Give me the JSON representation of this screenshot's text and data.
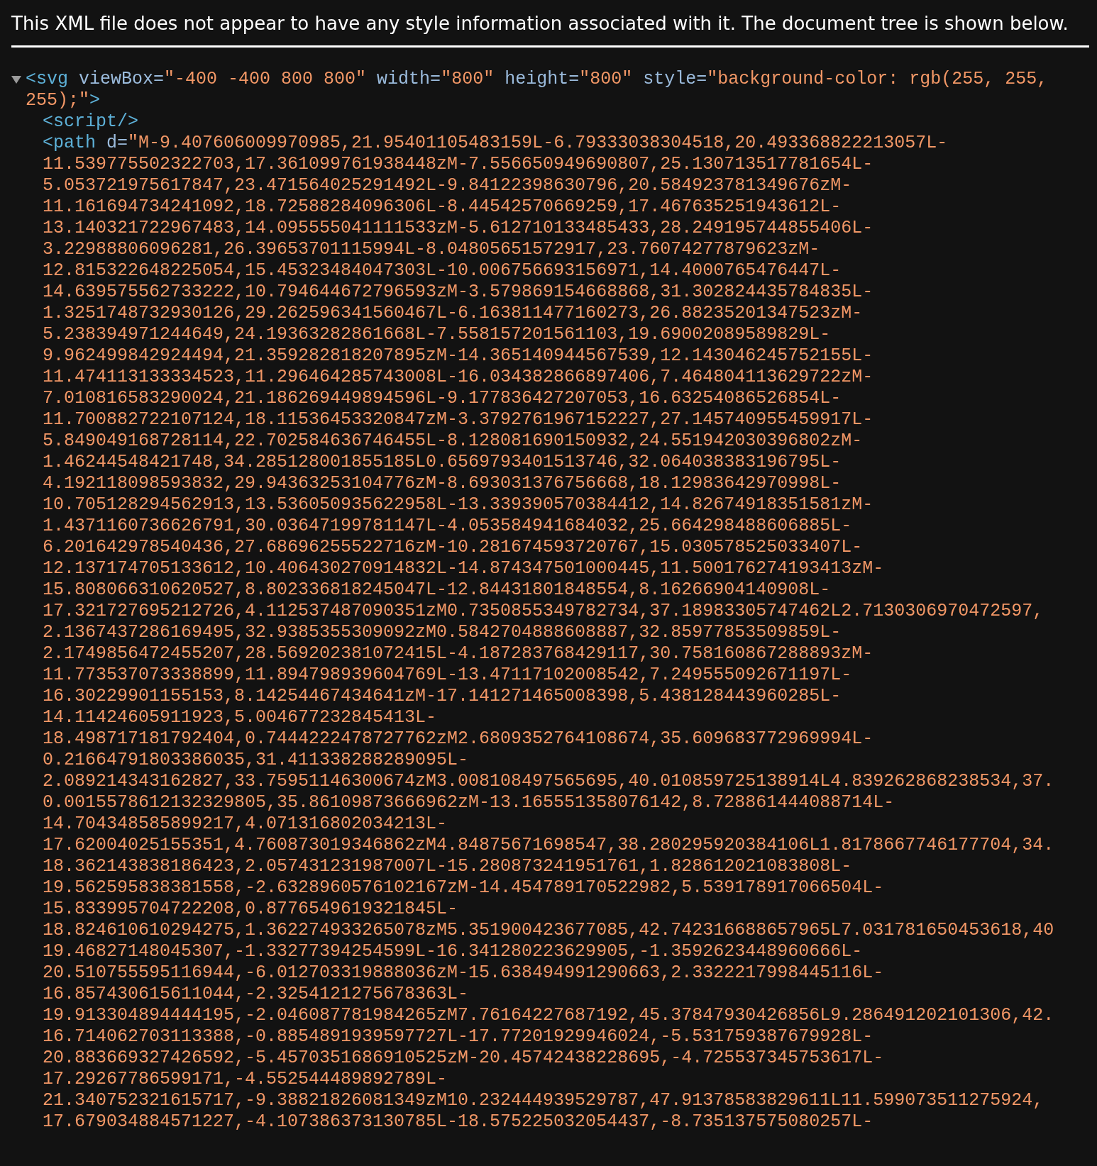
{
  "notice": "This XML file does not appear to have any style information associated with it. The document tree is shown below.",
  "tree": {
    "expanded": true,
    "lines": [
      [
        {
          "kind": "tag",
          "text": "<svg"
        },
        {
          "kind": "attr",
          "text": " viewBox="
        },
        {
          "kind": "value",
          "text": "\"-400 -400 800 800\""
        },
        {
          "kind": "attr",
          "text": " width="
        },
        {
          "kind": "value",
          "text": "\"800\""
        },
        {
          "kind": "attr",
          "text": " height="
        },
        {
          "kind": "value",
          "text": "\"800\""
        },
        {
          "kind": "attr",
          "text": " style="
        },
        {
          "kind": "value",
          "text": "\"background-color: rgb(255, 255,"
        }
      ],
      [
        {
          "kind": "value",
          "text": "255);\""
        },
        {
          "kind": "tag",
          "text": ">"
        }
      ]
    ],
    "children": [
      {
        "lines": [
          [
            {
              "kind": "tag",
              "text": "<script/>"
            }
          ]
        ]
      },
      {
        "lines": [
          [
            {
              "kind": "tag",
              "text": "<path"
            },
            {
              "kind": "attr",
              "text": " d="
            },
            {
              "kind": "value",
              "text": "\"M-9.407606009970985,21.95401105483159L-6.79333038304518,20.493368822213057L-"
            }
          ],
          [
            {
              "kind": "value",
              "text": "11.539775502322703,17.361099761938448zM-7.556650949690807,25.130713517781654L-"
            }
          ],
          [
            {
              "kind": "value",
              "text": "5.053721975617847,23.471564025291492L-9.84122398630796,20.584923781349676zM-"
            }
          ],
          [
            {
              "kind": "value",
              "text": "11.161694734241092,18.72588284096306L-8.44542570669259,17.467635251943612L-"
            }
          ],
          [
            {
              "kind": "value",
              "text": "13.140321722967483,14.095555041111533zM-5.612710133485433,28.249195744855406L-"
            }
          ],
          [
            {
              "kind": "value",
              "text": "3.22988806096281,26.39653701115994L-8.04805651572917,23.76074277879623zM-"
            }
          ],
          [
            {
              "kind": "value",
              "text": "12.815322648225054,15.45323484047303L-10.006756693156971,14.4000765476447L-"
            }
          ],
          [
            {
              "kind": "value",
              "text": "14.639575562733222,10.794644672796593zM-3.579869154668868,31.302824435784835L-"
            }
          ],
          [
            {
              "kind": "value",
              "text": "1.3251748732930126,29.262596341560467L-6.163811477160273,26.88235201347523zM-"
            }
          ],
          [
            {
              "kind": "value",
              "text": "5.238394971244649,24.19363282861668L-7.558157201561103,19.69002089589829L-"
            }
          ],
          [
            {
              "kind": "value",
              "text": "9.962499842924494,21.359282818207895zM-14.365140944567539,12.143046245752155L-"
            }
          ],
          [
            {
              "kind": "value",
              "text": "11.474113133334523,11.296464285743008L-16.034382866897406,7.464804113629722zM-"
            }
          ],
          [
            {
              "kind": "value",
              "text": "7.010816583290024,21.186269449894596L-9.177836427207053,16.63254086526854L-"
            }
          ],
          [
            {
              "kind": "value",
              "text": "11.700882722107124,18.11536453320847zM-3.3792761967152227,27.145740955459917L-"
            }
          ],
          [
            {
              "kind": "value",
              "text": "5.849049168728114,22.702584636746455L-8.128081690150932,24.551942030396802zM-"
            }
          ],
          [
            {
              "kind": "value",
              "text": "1.46244548421748,34.285128001855185L0.6569793401513746,32.064038383196795L-"
            }
          ],
          [
            {
              "kind": "value",
              "text": "4.192118098593832,29.94363253104776zM-8.693031376756668,18.12983642970998L-"
            }
          ],
          [
            {
              "kind": "value",
              "text": "10.705128294562913,13.536050935622958L-13.339390570384412,14.82674918351581zM-"
            }
          ],
          [
            {
              "kind": "value",
              "text": "1.4371160736626791,30.03647199781147L-4.053584941684032,25.664298488606885L-"
            }
          ],
          [
            {
              "kind": "value",
              "text": "6.201642978540436,27.68696255522716zM-10.281674593720767,15.030578525033407L-"
            }
          ],
          [
            {
              "kind": "value",
              "text": "12.137174705133612,10.406430270914832L-14.874347501000445,11.500176274193413zM-"
            }
          ],
          [
            {
              "kind": "value",
              "text": "15.808066310620527,8.802336818245047L-12.84431801848554,8.16266904140908L-"
            }
          ],
          [
            {
              "kind": "value",
              "text": "17.321727695212726,4.112537487090351zM0.7350855349782734,37.18983305747462L2.7130306970472597,"
            }
          ],
          [
            {
              "kind": "value",
              "text": "2.1367437286169495,32.9385355309092zM0.5842704888608887,32.85977853509859L-"
            }
          ],
          [
            {
              "kind": "value",
              "text": "2.1749856472455207,28.569202381072415L-4.187283768429117,30.758160867288893zM-"
            }
          ],
          [
            {
              "kind": "value",
              "text": "11.773537073338899,11.894798939604769L-13.47117102008542,7.249555092671197L-"
            }
          ],
          [
            {
              "kind": "value",
              "text": "16.30229901155153,8.14254467434641zM-17.141271465008398,5.438128443960285L-"
            }
          ],
          [
            {
              "kind": "value",
              "text": "14.11424605911923,5.004677232845413L-"
            }
          ],
          [
            {
              "kind": "value",
              "text": "18.498717181792404,0.7444222478727762zM2.6809352764108674,35.609683772969994L-"
            }
          ],
          [
            {
              "kind": "value",
              "text": "0.21664791803386035,31.411338288289095L-"
            }
          ],
          [
            {
              "kind": "value",
              "text": "2.089214343162827,33.75951146300674zM3.008108497565695,40.010859725138914L4.839262868238534,37."
            }
          ],
          [
            {
              "kind": "value",
              "text": "0.0015578612132329805,35.86109873666962zM-13.165551358076142,8.728861444088714L-"
            }
          ],
          [
            {
              "kind": "value",
              "text": "14.704348585899217,4.071316802034213L-"
            }
          ],
          [
            {
              "kind": "value",
              "text": "17.62004025155351,4.760873019346862zM4.84875671698547,38.280295920384106L1.8178667746177704,34."
            }
          ],
          [
            {
              "kind": "value",
              "text": "18.362143838186423,2.057431231987007L-15.280873241951761,1.828612021083808L-"
            }
          ],
          [
            {
              "kind": "value",
              "text": "19.562595838381558,-2.6328960576102167zM-14.454789170522982,5.539178917066504L-"
            }
          ],
          [
            {
              "kind": "value",
              "text": "15.833995704722208,0.8776549619321845L-"
            }
          ],
          [
            {
              "kind": "value",
              "text": "18.824610610294275,1.362274933265078zM5.351900423677085,42.742316688657965L7.031781650453618,40"
            }
          ],
          [
            {
              "kind": "value",
              "text": "19.46827148045307,-1.33277394254599L-16.341280223629905,-1.3592623448960666L-"
            }
          ],
          [
            {
              "kind": "value",
              "text": "20.510755595116944,-6.012703319888036zM-15.638494991290663,2.3322217998445116L-"
            }
          ],
          [
            {
              "kind": "value",
              "text": "16.857430615611044,-2.3254121275678363L-"
            }
          ],
          [
            {
              "kind": "value",
              "text": "19.913304894444195,-2.046087781984265zM7.76164227687192,45.37847930426856L9.286491202101306,42."
            }
          ],
          [
            {
              "kind": "value",
              "text": "16.714062703113388,-0.8854891939597727L-17.77201929946024,-5.531759387679928L-"
            }
          ],
          [
            {
              "kind": "value",
              "text": "20.883669327426592,-5.4570351686910525zM-20.45742438228695,-4.725537345753617L-"
            }
          ],
          [
            {
              "kind": "value",
              "text": "17.29267786599171,-4.552544489892789L-"
            }
          ],
          [
            {
              "kind": "value",
              "text": "21.340752321615717,-9.38821826081349zM10.232444939529787,47.91378583829611L11.599073511275924,"
            }
          ],
          [
            {
              "kind": "value",
              "text": "17.679034884571227,-4.107386373130785L-18.575225032054437,-8.735137575080257L-"
            }
          ]
        ]
      }
    ]
  }
}
